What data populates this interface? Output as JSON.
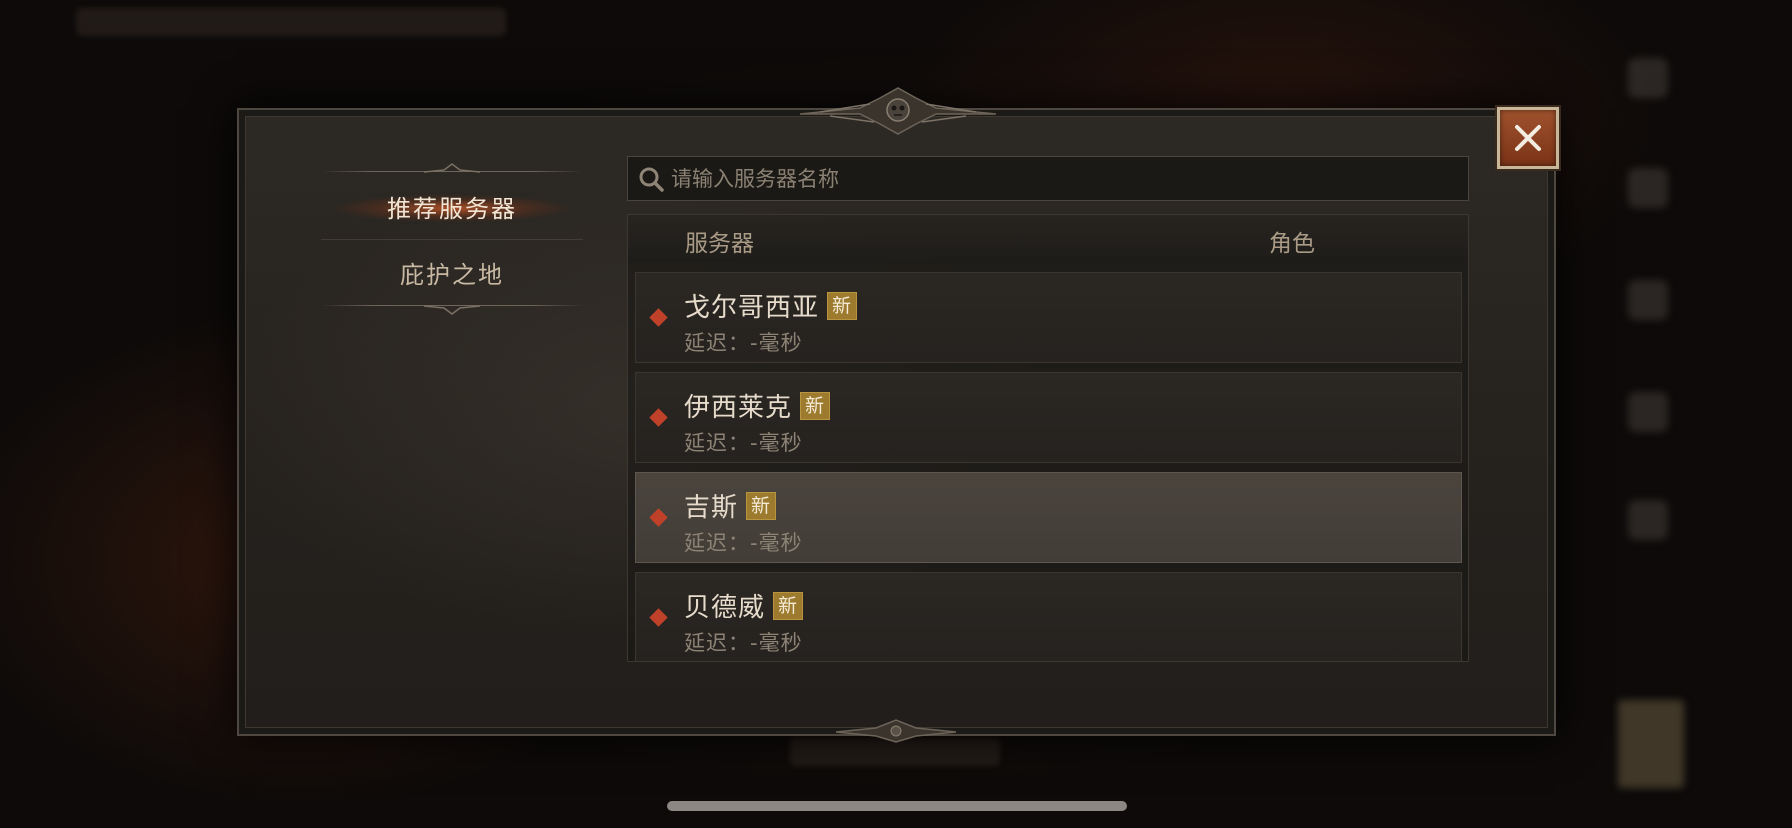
{
  "menu": {
    "items": [
      {
        "label": "推荐服务器",
        "active": true
      },
      {
        "label": "庇护之地",
        "active": false
      }
    ]
  },
  "search": {
    "placeholder": "请输入服务器名称",
    "icon": "search-icon"
  },
  "table": {
    "headers": {
      "server": "服务器",
      "character": "角色"
    },
    "rows": [
      {
        "name": "戈尔哥西亚",
        "badge": "新",
        "latency": "延迟：-毫秒",
        "selected": false
      },
      {
        "name": "伊西莱克",
        "badge": "新",
        "latency": "延迟：-毫秒",
        "selected": false
      },
      {
        "name": "吉斯",
        "badge": "新",
        "latency": "延迟：-毫秒",
        "selected": true
      },
      {
        "name": "贝德威",
        "badge": "新",
        "latency": "延迟：-毫秒",
        "selected": false
      }
    ]
  },
  "close": {
    "icon": "close-icon"
  },
  "colors": {
    "accent": "#c0412a",
    "badge": "#9c7a2e",
    "close_button": "#8b3e1c",
    "panel": "#2a2622"
  }
}
